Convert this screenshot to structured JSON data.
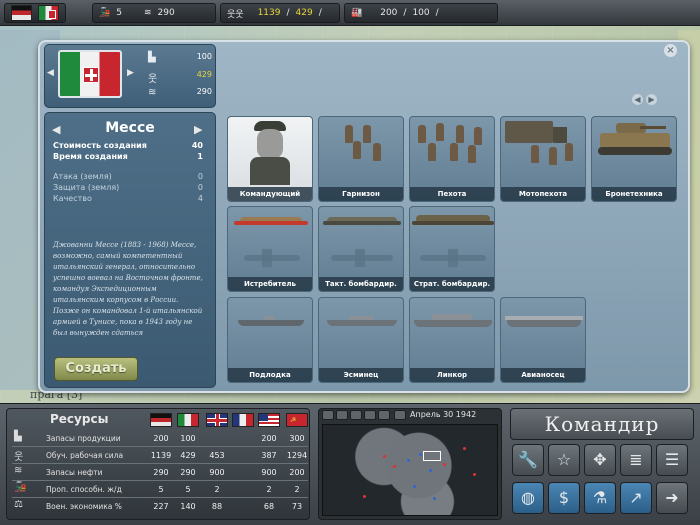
{
  "topbar": {
    "trains": "5",
    "oil": "290",
    "manpower_a": "1139",
    "manpower_b": "429",
    "slash": "/",
    "production_a": "200",
    "production_b": "100",
    "icons": [
      "train-icon",
      "oil-barrel-icon",
      "soldiers-icon",
      "factory-icon"
    ]
  },
  "nation": {
    "production": "100",
    "manpower": "429",
    "oil": "290"
  },
  "unit": {
    "name": "Мессе",
    "cost_label": "Стоимость создания",
    "cost_value": "40",
    "time_label": "Время создания",
    "time_value": "1",
    "attack_label": "Атака (земля)",
    "attack_value": "0",
    "defense_label": "Защита (земля)",
    "defense_value": "0",
    "quality_label": "Качество",
    "quality_value": "4",
    "bio": "Джованни Мессе (1883 - 1968) Мессе, возможно, самый компетентный итальянский генерал, относительно успешно воевал на Восточном фронте, командуя Экспедиционным итальянским корпусом в России. Позже он командовал 1-й итальянской армией в Тунисе, пока в 1943 году не был вынужден сдаться"
  },
  "create_button": "Создать",
  "units": [
    {
      "label": "Командующий"
    },
    {
      "label": "Гарнизон"
    },
    {
      "label": "Пехота"
    },
    {
      "label": "Мотопехота"
    },
    {
      "label": "Бронетехника"
    },
    {
      "label": "Истребитель"
    },
    {
      "label": "Такт. бомбардир."
    },
    {
      "label": "Страт. бомбардир."
    },
    {
      "label": "Подлодка"
    },
    {
      "label": "Эсминец"
    },
    {
      "label": "Линкор"
    },
    {
      "label": "Авианосец"
    }
  ],
  "resources": {
    "title": "Ресурсы",
    "rows": [
      {
        "label": "Запасы продукции",
        "values": [
          "200",
          "100",
          "",
          "200",
          "",
          "300"
        ]
      },
      {
        "label": "Обуч. рабочая сила",
        "values": [
          "1139",
          "429",
          "453",
          "387",
          "",
          "1294"
        ]
      },
      {
        "label": "Запасы нефти",
        "values": [
          "290",
          "290",
          "900",
          "900",
          "",
          "200"
        ]
      },
      {
        "label": "Проп. способн. ж/д",
        "values": [
          "5",
          "5",
          "2",
          "2",
          "",
          "2"
        ]
      },
      {
        "label": "Воен. экономика %",
        "values": [
          "227",
          "140",
          "88",
          "68",
          "",
          "73"
        ]
      }
    ]
  },
  "minimap": {
    "date": "Апрель 30 1942"
  },
  "commander": {
    "title": "Командир"
  },
  "map": {
    "label": "прага [3]"
  },
  "colors": {
    "yellow": "#e8d53a",
    "panel": "#7e98ab",
    "accent_green": "#80894b"
  }
}
